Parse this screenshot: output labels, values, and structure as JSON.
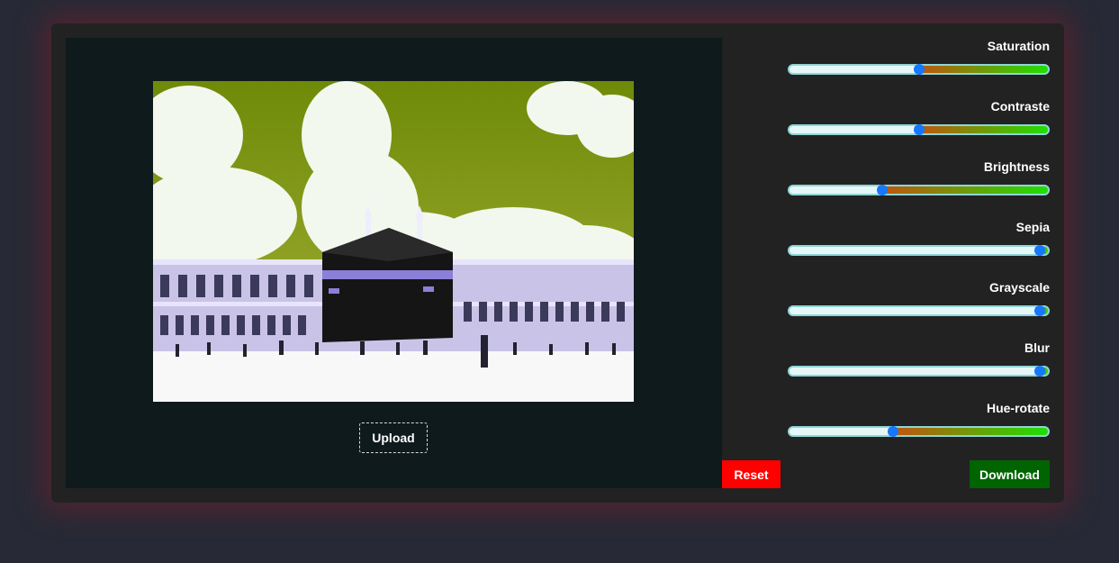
{
  "image": {
    "subject": "kaaba-photo",
    "filtered": true,
    "sky_color": "#7f9413"
  },
  "buttons": {
    "upload": "Upload",
    "reset": "Reset",
    "download": "Download"
  },
  "sliders": [
    {
      "label": "Saturation",
      "value": 0.5
    },
    {
      "label": "Contraste",
      "value": 0.5
    },
    {
      "label": "Brightness",
      "value": 0.36
    },
    {
      "label": "Sepia",
      "value": 0.97
    },
    {
      "label": "Grayscale",
      "value": 0.97
    },
    {
      "label": "Blur",
      "value": 0.97
    },
    {
      "label": "Hue-rotate",
      "value": 0.4
    }
  ],
  "colors": {
    "page_bg": "#272a36",
    "card_bg": "#222222",
    "preview_bg": "#0e1a1c",
    "track_empty": "#e6f7f7",
    "track_fill_start": "#c0540e",
    "track_fill_end": "#1fe000",
    "thumb": "#1677ff",
    "reset": "#ff0000",
    "download": "#006400"
  }
}
